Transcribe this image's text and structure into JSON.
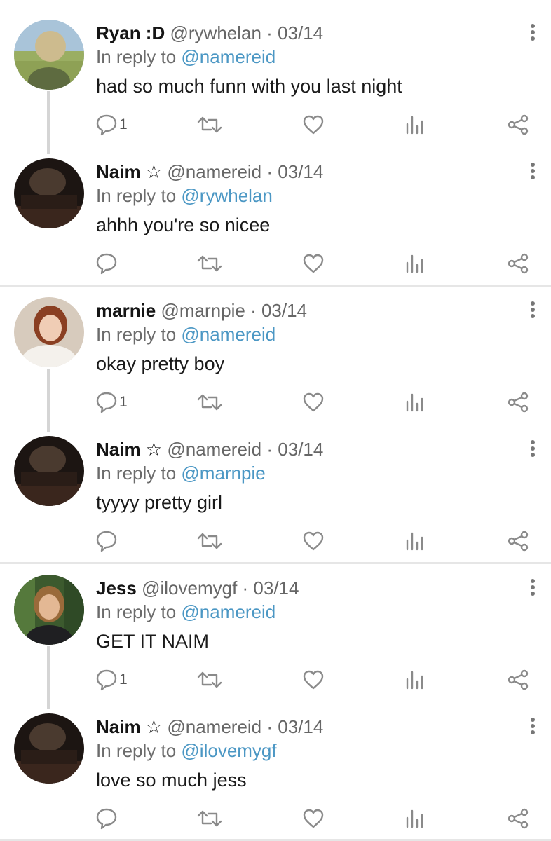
{
  "thread": [
    {
      "name": "Ryan :D",
      "handle": "@rywhelan",
      "date": "· 03/14",
      "reply_prefix": "In reply to",
      "reply_to": "@namereid",
      "text": "had so much funn with you last night",
      "reply_count": "1",
      "avatar_icon": "photo-field-avatar"
    },
    {
      "name": "Naim ☆",
      "handle": "@namereid",
      "date": "· 03/14",
      "reply_prefix": "In reply to",
      "reply_to": "@rywhelan",
      "text": "ahhh you're so nicee",
      "reply_count": "",
      "avatar_icon": "photo-dark-avatar"
    },
    {
      "name": "marnie",
      "handle": "@marnpie",
      "date": "· 03/14",
      "reply_prefix": "In reply to",
      "reply_to": "@namereid",
      "text": "okay pretty boy",
      "reply_count": "1",
      "avatar_icon": "photo-portrait-avatar"
    },
    {
      "name": "Naim ☆",
      "handle": "@namereid",
      "date": "· 03/14",
      "reply_prefix": "In reply to",
      "reply_to": "@marnpie",
      "text": "tyyyy pretty girl",
      "reply_count": "",
      "avatar_icon": "photo-dark-avatar"
    },
    {
      "name": "Jess",
      "handle": "@ilovemygf",
      "date": "· 03/14",
      "reply_prefix": "In reply to",
      "reply_to": "@namereid",
      "text": "GET IT NAIM",
      "reply_count": "1",
      "avatar_icon": "photo-portrait-avatar"
    },
    {
      "name": "Naim ☆",
      "handle": "@namereid",
      "date": "· 03/14",
      "reply_prefix": "In reply to",
      "reply_to": "@ilovemygf",
      "text": "love so much jess",
      "reply_count": "",
      "avatar_icon": "photo-dark-avatar"
    }
  ],
  "colors": {
    "mention": "#4b97c4",
    "secondary_text": "#666666",
    "icon": "#8a8a8a",
    "divider": "#e6e6e6",
    "thread_line": "#d5d5d5"
  },
  "icons": {
    "reply": "speech-bubble-icon",
    "retweet": "retweet-icon",
    "like": "heart-icon",
    "stats": "bar-chart-icon",
    "share": "share-icon",
    "more": "vertical-dots-icon"
  }
}
